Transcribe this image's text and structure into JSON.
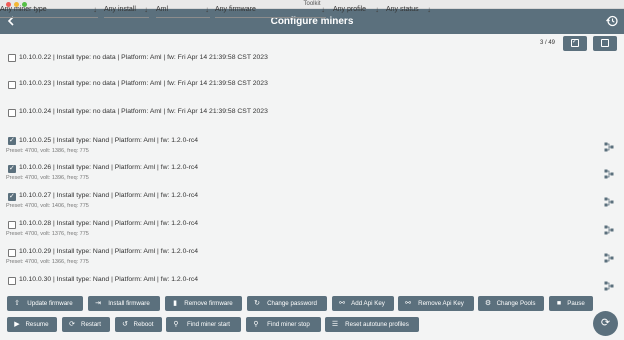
{
  "window": {
    "title": "Toolkit"
  },
  "appbar": {
    "title": "Configure miners",
    "back_icon": "arrow-left-icon",
    "history_icon": "history-icon"
  },
  "filters": {
    "miner_type": "Any miner type",
    "install": "Any install",
    "platform": "Aml",
    "firmware": "Any firmware",
    "profile": "Any profile",
    "status": "Any status"
  },
  "selection": {
    "count": "3 / 49"
  },
  "rows": [
    {
      "main": "10.10.0.22 | Install type: no data | Platform: Aml | fw: Fri Apr 14 21:39:58 CST 2023",
      "sub": "",
      "checked": false
    },
    {
      "main": "10.10.0.23 | Install type: no data | Platform: Aml | fw: Fri Apr 14 21:39:58 CST 2023",
      "sub": "",
      "checked": false
    },
    {
      "main": "10.10.0.24 | Install type: no data | Platform: Aml | fw: Fri Apr 14 21:39:58 CST 2023",
      "sub": "",
      "checked": false
    },
    {
      "main": "10.10.0.25 | Install type: Nand | Platform: Aml | fw: 1.2.0-rc4",
      "sub": "Preset: 4700, volt: 1386, freq: 775",
      "checked": true
    },
    {
      "main": "10.10.0.26 | Install type: Nand | Platform: Aml | fw: 1.2.0-rc4",
      "sub": "Preset: 4700, volt: 1396, freq: 775",
      "checked": true
    },
    {
      "main": "10.10.0.27 | Install type: Nand | Platform: Aml | fw: 1.2.0-rc4",
      "sub": "Preset: 4700, volt: 1406, freq: 775",
      "checked": true
    },
    {
      "main": "10.10.0.28 | Install type: Nand | Platform: Aml | fw: 1.2.0-rc4",
      "sub": "Preset: 4700, volt: 1376, freq: 775",
      "checked": false
    },
    {
      "main": "10.10.0.29 | Install type: Nand | Platform: Aml | fw: 1.2.0-rc4",
      "sub": "Preset: 4700, volt: 1366, freq: 775",
      "checked": false
    },
    {
      "main": "10.10.0.30 | Install type: Nand | Platform: Aml | fw: 1.2.0-rc4",
      "sub": "",
      "checked": false
    }
  ],
  "actions": {
    "update_firmware": "Update firmware",
    "install_firmware": "Install firmware",
    "remove_firmware": "Remove firmware",
    "change_password": "Change password",
    "add_api_key": "Add Api Key",
    "remove_api_key": "Remove Api Key",
    "change_pools": "Change Pools",
    "pause": "Pause",
    "resume": "Resume",
    "restart": "Restart",
    "reboot": "Reboot",
    "find_miner_start": "Find miner start",
    "find_miner_stop": "Find miner stop",
    "reset_autotune_profiles": "Reset autotune profiles"
  },
  "colors": {
    "primary": "#5b707d",
    "background": "#f3f4f4"
  }
}
